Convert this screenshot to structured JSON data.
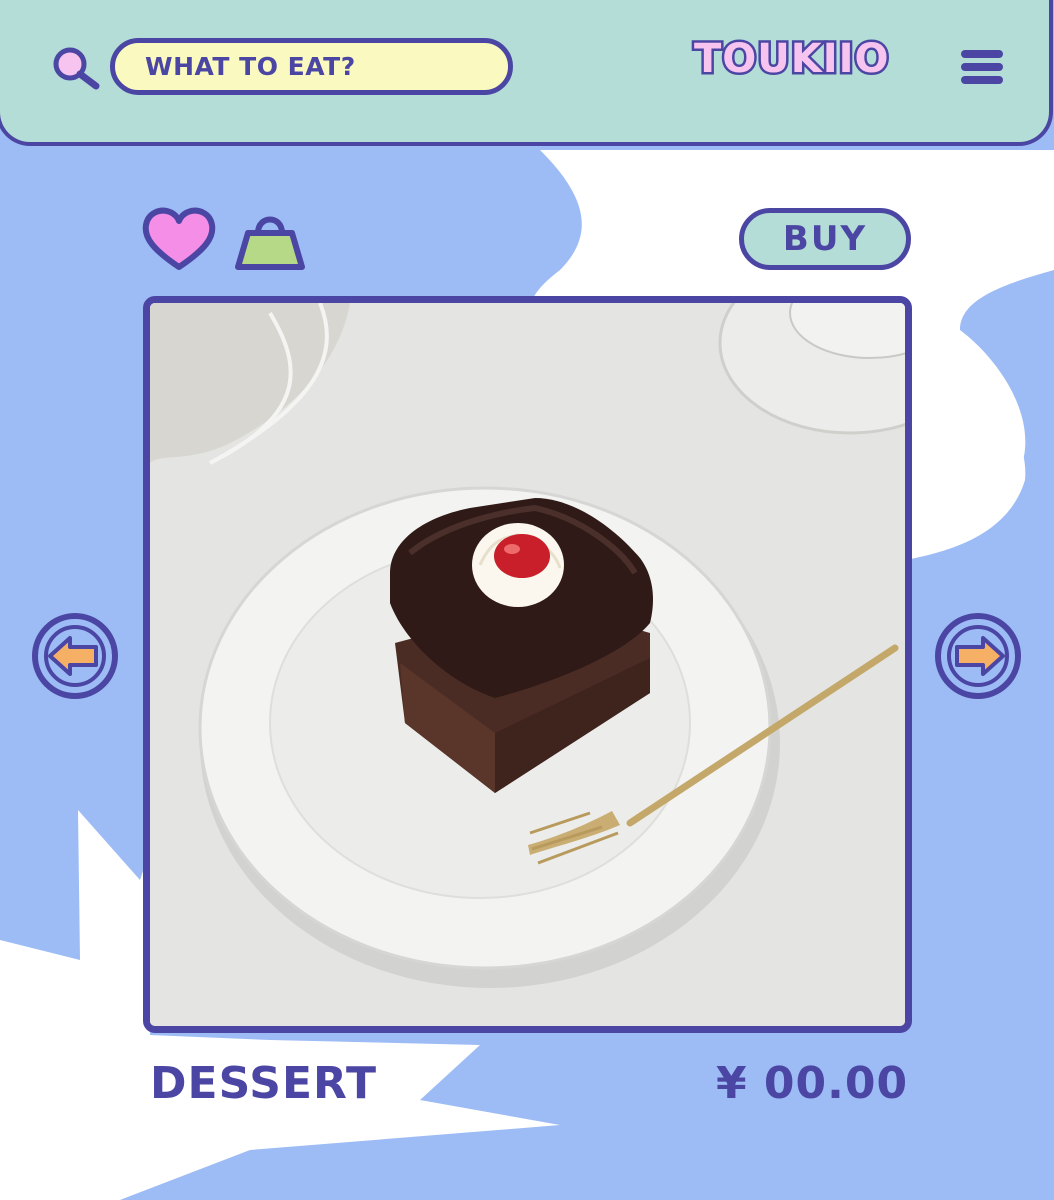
{
  "header": {
    "search_placeholder": "WHAT TO EAT?",
    "brand": "TOUKIIO",
    "search_icon": "search-icon",
    "menu_icon": "hamburger-menu-icon"
  },
  "actions": {
    "favorite_icon": "heart-icon",
    "cart_icon": "shopping-bag-icon",
    "buy_label": "BUY"
  },
  "product": {
    "image_subject": "chocolate cake with cream and cherry on white plate with gold fork",
    "name": "DESSERT",
    "price": "¥ 00.00"
  },
  "carousel": {
    "prev_icon": "arrow-left-icon",
    "next_icon": "arrow-right-icon"
  },
  "colors": {
    "background_blue": "#9dbcf5",
    "header_mint": "#b3ddd6",
    "outline_purple": "#4b46a3",
    "search_yellow": "#fafac0",
    "heart_pink": "#f48ee6",
    "bag_green": "#b5d986",
    "arrow_orange": "#f5b066",
    "white_shape": "#ffffff"
  }
}
